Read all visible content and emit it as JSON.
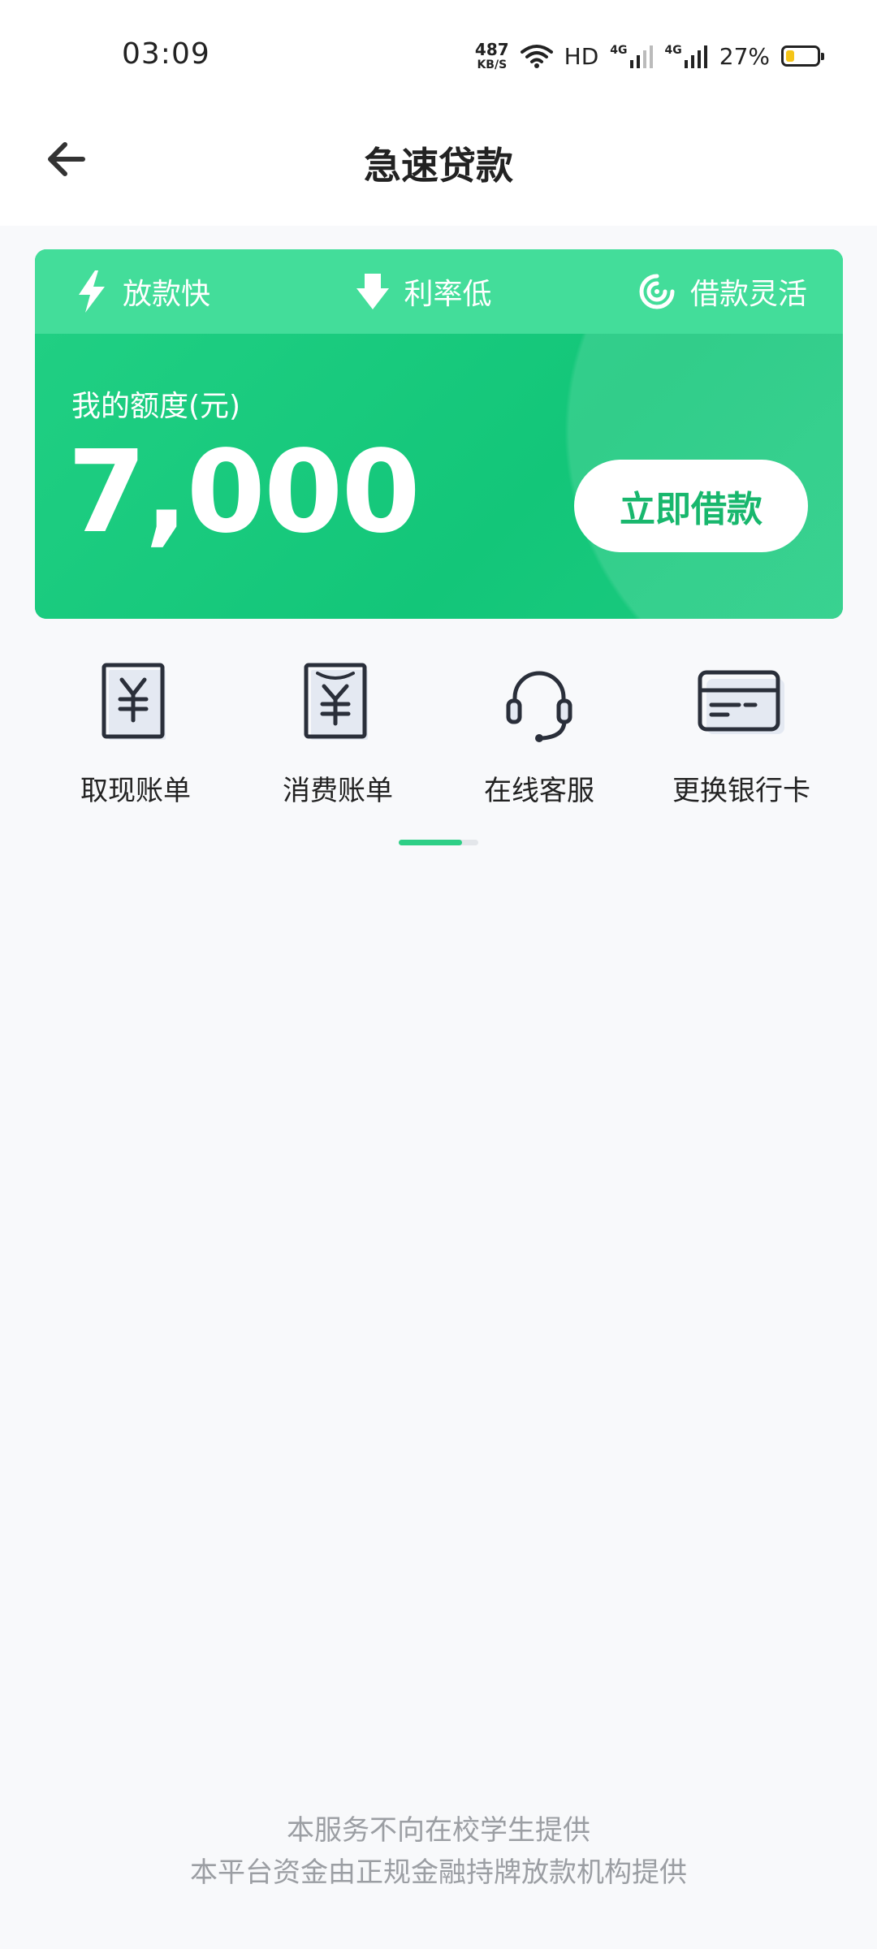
{
  "status_bar": {
    "time": "03:09",
    "net_speed_value": "487",
    "net_speed_unit": "KB/S",
    "hd_label": "HD",
    "network_1": "4G",
    "network_2": "4G",
    "battery_percent": "27%",
    "battery_level": 0.27,
    "battery_color": "#f5c518"
  },
  "header": {
    "title": "急速贷款",
    "back_icon": "arrow-left-icon"
  },
  "card": {
    "features": [
      {
        "label": "放款快",
        "icon": "lightning-icon"
      },
      {
        "label": "利率低",
        "icon": "down-arrow-icon"
      },
      {
        "label": "借款灵活",
        "icon": "spiral-icon"
      }
    ],
    "quota_label": "我的额度(元)",
    "quota_amount": "7,000",
    "borrow_button": "立即借款",
    "accent_color": "#1dcc7e"
  },
  "menu": [
    {
      "label": "取现账单",
      "icon": "yuan-receipt-icon"
    },
    {
      "label": "消费账单",
      "icon": "yuan-bill-icon"
    },
    {
      "label": "在线客服",
      "icon": "headset-icon"
    },
    {
      "label": "更换银行卡",
      "icon": "bank-card-icon"
    }
  ],
  "footer": {
    "line1": "本服务不向在校学生提供",
    "line2": "本平台资金由正规金融持牌放款机构提供"
  }
}
